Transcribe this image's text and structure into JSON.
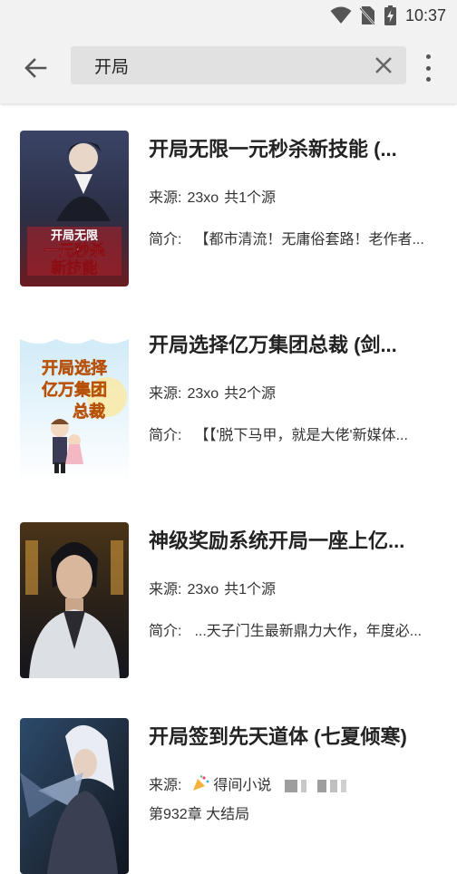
{
  "status_bar": {
    "time": "10:37"
  },
  "search": {
    "value": "开局",
    "placeholder": ""
  },
  "books": [
    {
      "title": "开局无限一元秒杀新技能 (...",
      "source_label": "来源:",
      "source": "23xo",
      "source_count": "共1个源",
      "intro_label": "简介:",
      "intro": "【都市清流！无庸俗套路！老作者...",
      "cover_text": [
        "开局无限",
        "一元秒杀",
        "新技能"
      ],
      "cover_colors": [
        "#2b2f45",
        "#7a1f22"
      ]
    },
    {
      "title": "开局选择亿万集团总裁 (剑...",
      "source_label": "来源:",
      "source": "23xo",
      "source_count": "共2个源",
      "intro_label": "简介:",
      "intro": "【【'脱下马甲，就是大佬'新媒体...",
      "cover_text": [
        "开局选择",
        "亿万集团",
        "总裁"
      ],
      "cover_colors": [
        "#dff1fb",
        "#ffffff"
      ]
    },
    {
      "title": "神级奖励系统开局一座上亿...",
      "source_label": "来源:",
      "source": "23xo",
      "source_count": "共1个源",
      "intro_label": "简介:",
      "intro": "...天子门生最新鼎力大作，年度必...",
      "cover_text": [],
      "cover_colors": [
        "#3a2a1a",
        "#1a1a22"
      ]
    },
    {
      "title": "开局签到先天道体 (七夏倾寒)",
      "source_label": "来源:",
      "source": "得间小说",
      "source_count": "",
      "intro_label": "",
      "intro": "",
      "latest_chapter": "第932章 大结局",
      "cover_text": [],
      "cover_colors": [
        "#1e2a3a",
        "#5a6a8a"
      ]
    }
  ]
}
